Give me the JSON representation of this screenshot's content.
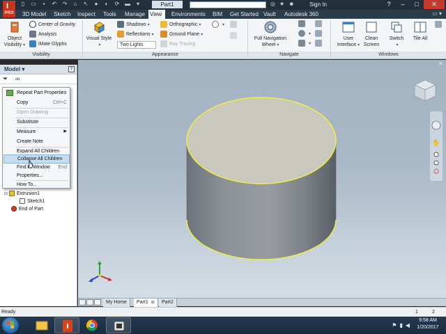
{
  "window": {
    "doc_title": "Part1",
    "search_placeholder": "",
    "signin": "Sign In",
    "app_badge": "PRO"
  },
  "ribbon_tabs": [
    {
      "label": "3D Model"
    },
    {
      "label": "Sketch"
    },
    {
      "label": "Inspect"
    },
    {
      "label": "Tools"
    },
    {
      "label": "Manage"
    },
    {
      "label": "View"
    },
    {
      "label": "Environments"
    },
    {
      "label": "BIM"
    },
    {
      "label": "Get Started"
    },
    {
      "label": "Vault"
    },
    {
      "label": "Autodesk 360"
    }
  ],
  "active_tab": "View",
  "ribbon": {
    "visibility": {
      "object_visibility_line1": "Object",
      "object_visibility_line2": "Visibility",
      "center_of_gravity": "Center of Gravity",
      "analysis": "Analysis",
      "imate_glyphs": "iMate Glyphs",
      "group_label": "Visibility"
    },
    "appearance": {
      "visual_style": "Visual Style",
      "shadows": "Shadows",
      "reflections": "Reflections",
      "lighting_combo": "Two Lights",
      "orthographic": "Orthographic",
      "ground_plane": "Ground Plane",
      "ray_tracing": "Ray Tracing",
      "group_label": "Appearance"
    },
    "navigate": {
      "full_nav_line1": "Full Navigation",
      "full_nav_line2": "Wheel",
      "group_label": "Navigate"
    },
    "windows": {
      "user_interface_line1": "User",
      "user_interface_line2": "Interface",
      "clean_screen_line1": "Clean",
      "clean_screen_line2": "Screen",
      "switch": "Switch",
      "tile_all": "Tile All",
      "group_label": "Windows"
    }
  },
  "browser": {
    "title": "Model",
    "help": "?",
    "tree": [
      {
        "label": "Extrusion1"
      },
      {
        "label": "Sketch1"
      },
      {
        "label": "End of Part"
      }
    ]
  },
  "context_menu": {
    "items": [
      {
        "label": "Repeat Part Properties",
        "shortcut": "",
        "disabled": false
      },
      {
        "label": "Copy",
        "shortcut": "Ctrl+C",
        "disabled": false
      },
      {
        "label": "Open Drawing",
        "shortcut": "",
        "disabled": true
      },
      {
        "label": "Substitute",
        "shortcut": "",
        "disabled": false
      },
      {
        "label": "Measure",
        "shortcut": "",
        "disabled": false
      },
      {
        "label": "Create Note",
        "shortcut": "",
        "disabled": false
      },
      {
        "label": "Expand All Children",
        "shortcut": "",
        "disabled": false
      },
      {
        "label": "Collapse All Children",
        "shortcut": "",
        "disabled": false
      },
      {
        "label": "Find in Window",
        "shortcut": "End",
        "disabled": false
      },
      {
        "label": "Properties...",
        "shortcut": "",
        "disabled": false
      },
      {
        "label": "How To...",
        "shortcut": "",
        "disabled": false
      }
    ],
    "highlighted": "Collapse All Children"
  },
  "doc_tabs": [
    {
      "label": "My Home",
      "active": false
    },
    {
      "label": "Part1",
      "active": true
    },
    {
      "label": "Part2",
      "active": false
    }
  ],
  "status": {
    "text": "Ready",
    "count1": "1",
    "count2": "2"
  },
  "taskbar": {
    "time": "9:58 AM",
    "date": "1/20/2017"
  },
  "colors": {
    "title_bar": "#22303c",
    "active_tab_bg": "#f3f5f7",
    "viewport_top": "#a3b3c1",
    "viewport_bottom": "#d3dde5",
    "cylinder_top_face": "#c9c8bd",
    "cylinder_edge_highlight": "#f3f03a",
    "menu_highlight": "#c7ddf2"
  }
}
